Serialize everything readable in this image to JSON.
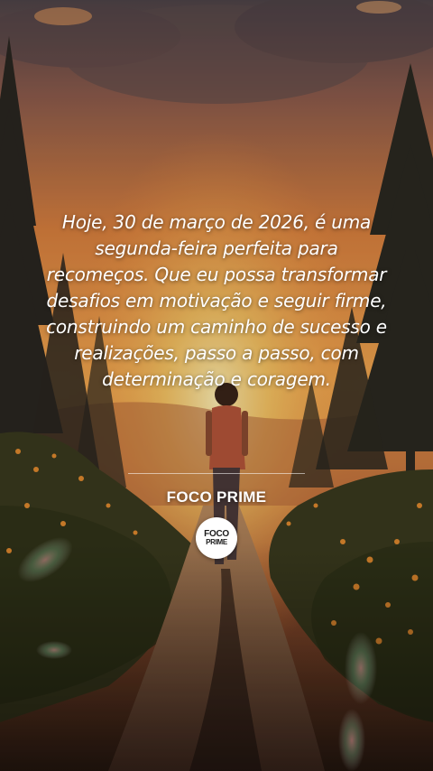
{
  "quote": {
    "text": "Hoje, 30 de março de 2026, é uma segunda-feira perfeita para recomeços. Que eu possa transformar desafios em motivação e seguir firme, construindo um caminho de sucesso e realizações, passo a passo, com determinação e coragem."
  },
  "brand": {
    "name": "FOCO PRIME",
    "logo_line_1": "FOCO",
    "logo_line_2": "PRIME"
  },
  "scene": {
    "description_icon": "person-walking-on-path-at-sunset",
    "colors": {
      "sky_top": "#5b4a4e",
      "sky_glow": "#f0a04a",
      "horizon": "#f6d37a",
      "foliage": "#2c3a1f",
      "path": "#7a4f3a"
    }
  }
}
